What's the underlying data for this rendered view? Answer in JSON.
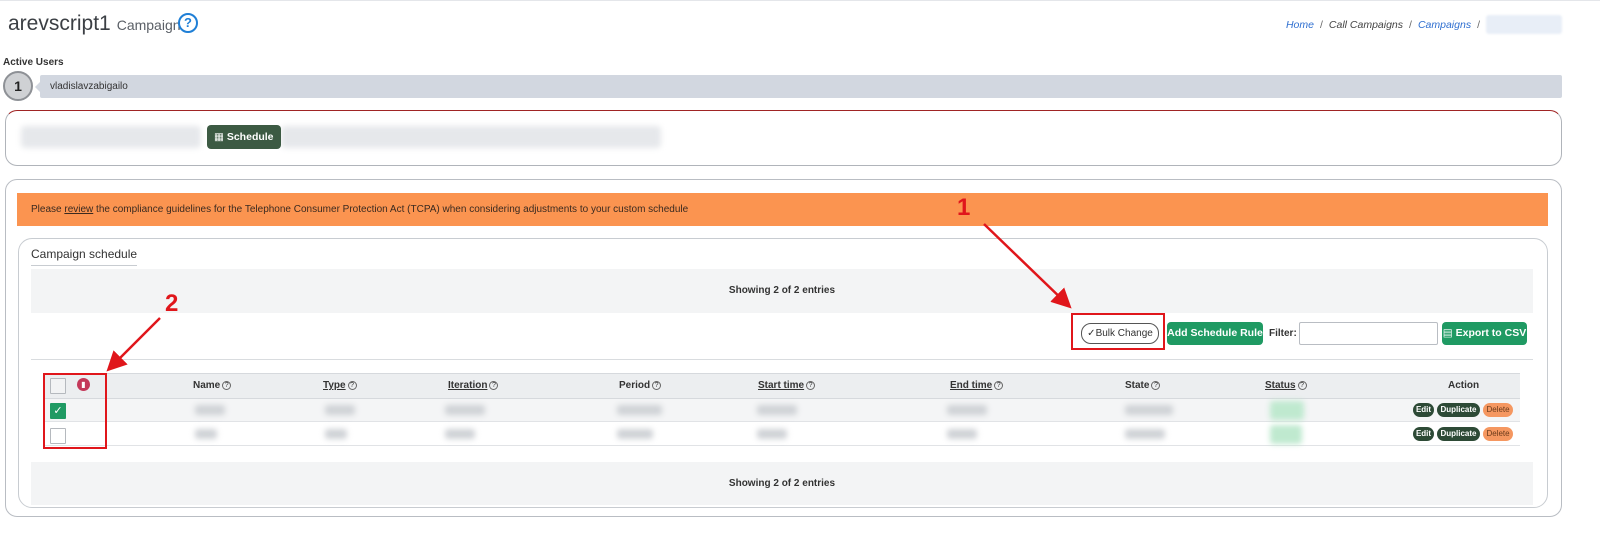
{
  "header": {
    "title": "arevscript1",
    "subtitle": "Campaign",
    "help_icon": "question-circle-icon",
    "breadcrumb": [
      {
        "label": "Home",
        "style": "link"
      },
      {
        "label": "Call Campaigns",
        "style": "plain"
      },
      {
        "label": "Campaigns",
        "style": "link"
      }
    ],
    "separator": "/"
  },
  "active_users": {
    "label": "Active Users",
    "count": "1",
    "user": "vladislavzabigailo"
  },
  "toolbar": {
    "schedule_label": "Schedule",
    "schedule_icon": "calendar-icon"
  },
  "alert": {
    "prefix": "Please ",
    "link": "review",
    "suffix": " the compliance guidelines for the Telephone Consumer Protection Act (TCPA) when considering adjustments to your custom schedule",
    "color": "#fb9450"
  },
  "schedule": {
    "title": "Campaign schedule",
    "showing_top": "Showing 2 of 2 entries",
    "showing_bottom": "Showing 2 of 2 entries",
    "bulk_change": "Bulk Change",
    "add_rule": "Add Schedule Rule",
    "filter_label": "Filter:",
    "filter_value": "",
    "export": "Export to CSV",
    "columns": [
      "Name",
      "Type",
      "Iteration",
      "Period",
      "Start time",
      "End time",
      "State",
      "Status",
      "Action"
    ],
    "row_actions": {
      "edit": "Edit",
      "duplicate": "Duplicate",
      "delete": "Delete"
    },
    "rows": [
      {
        "checked": true
      },
      {
        "checked": false
      }
    ]
  },
  "annotations": {
    "label_1": "1",
    "label_2": "2",
    "color": "#e0161b"
  },
  "colors": {
    "primary_green": "#1f9a63",
    "dark_green": "#2d4a36",
    "accent_blue": "#1f7fd6"
  }
}
